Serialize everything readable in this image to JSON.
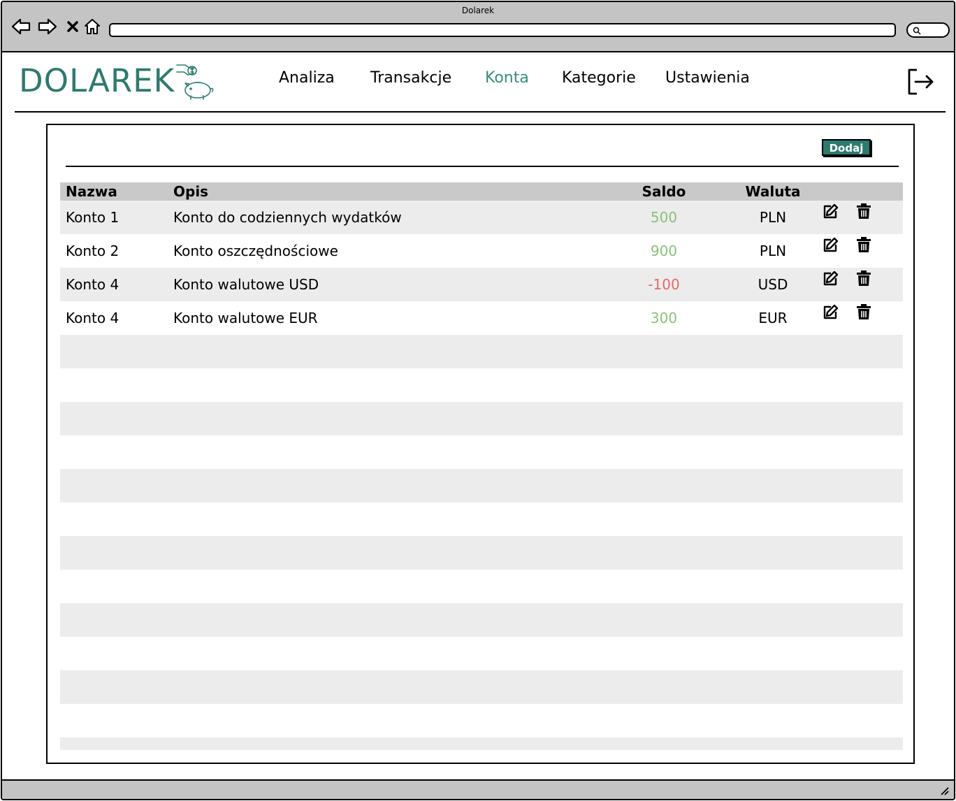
{
  "browser": {
    "title": "Dolarek",
    "icons": [
      "back-arrow-icon",
      "forward-arrow-icon",
      "close-icon",
      "home-icon",
      "search-icon"
    ]
  },
  "header": {
    "logo_text": "DOLAREK",
    "nav": [
      {
        "label": "Analiza",
        "active": false
      },
      {
        "label": "Transakcje",
        "active": false
      },
      {
        "label": "Konta",
        "active": true
      },
      {
        "label": "Kategorie",
        "active": false
      },
      {
        "label": "Ustawienia",
        "active": false
      }
    ],
    "logout_icon": "logout-icon"
  },
  "panel": {
    "add_label": "Dodaj"
  },
  "table": {
    "columns": {
      "name": "Nazwa",
      "desc": "Opis",
      "saldo": "Saldo",
      "currency": "Waluta"
    },
    "rows": [
      {
        "name": "Konto 1",
        "desc": "Konto do codziennych wydatków",
        "saldo": "500",
        "currency": "PLN"
      },
      {
        "name": "Konto 2",
        "desc": "Konto oszczędnościowe",
        "saldo": "900",
        "currency": "PLN"
      },
      {
        "name": "Konto 4",
        "desc": "Konto walutowe USD",
        "saldo": "-100",
        "currency": "USD"
      },
      {
        "name": "Konto 4",
        "desc": "Konto walutowe EUR",
        "saldo": "300",
        "currency": "EUR"
      }
    ]
  },
  "colors": {
    "brand": "#2f7a6e",
    "active_nav": "#3a8a7c",
    "positive": "#8cbf7a",
    "negative": "#e06a6a",
    "header_row": "#c9c9c9",
    "alt_row": "#ececec"
  }
}
